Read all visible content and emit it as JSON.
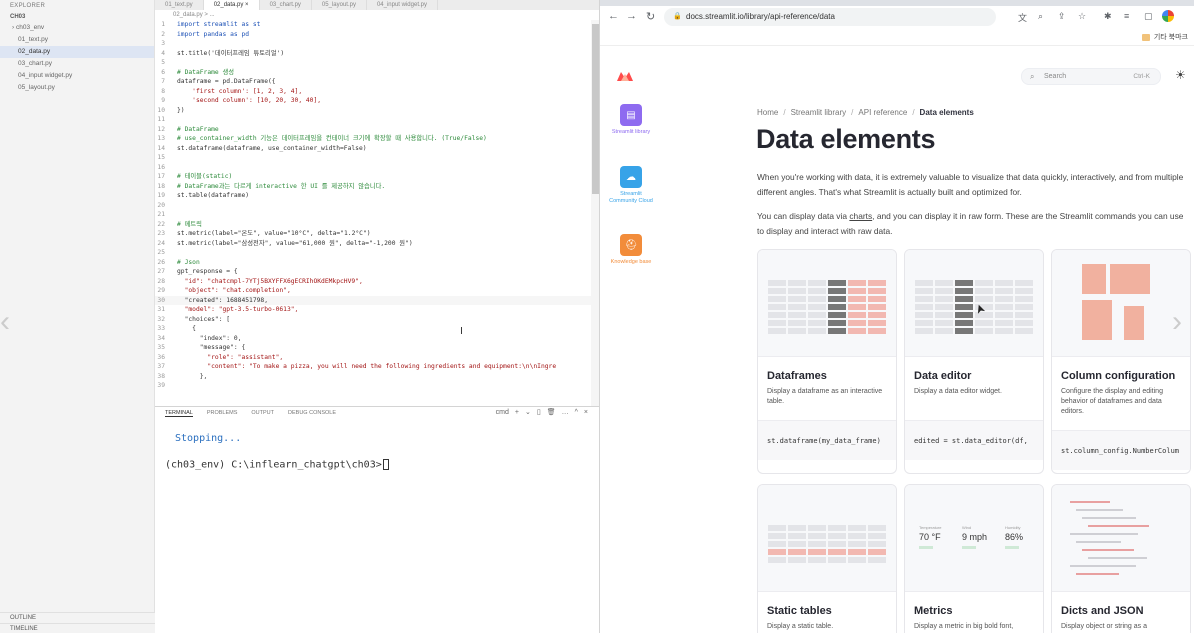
{
  "vscode": {
    "explorer": {
      "title": "EXPLORER",
      "folder": "CH03",
      "items": [
        {
          "label": "ch03_env",
          "sub": false,
          "active": false
        },
        {
          "label": "01_text.py",
          "sub": true,
          "active": false
        },
        {
          "label": "02_data.py",
          "sub": true,
          "active": true
        },
        {
          "label": "03_chart.py",
          "sub": true,
          "active": false
        },
        {
          "label": "04_input widget.py",
          "sub": true,
          "active": false
        },
        {
          "label": "05_layout.py",
          "sub": true,
          "active": false
        }
      ],
      "outline": "OUTLINE",
      "timeline": "TIMELINE"
    },
    "tabs": [
      "01_text.py",
      "02_data.py  ×",
      "03_chart.py",
      "05_layout.py",
      "04_input widget.py"
    ],
    "breadcrumb": "02_data.py > ...",
    "code_lines": [
      {
        "n": "1",
        "t": "import streamlit as st",
        "k": "kw"
      },
      {
        "n": "2",
        "t": "import pandas as pd",
        "k": "kw"
      },
      {
        "n": "3",
        "t": "",
        "k": ""
      },
      {
        "n": "4",
        "t": "st.title('데이터프레임 튜토리얼')",
        "k": ""
      },
      {
        "n": "5",
        "t": "",
        "k": ""
      },
      {
        "n": "6",
        "t": "# DataFrame 생성",
        "k": "cm"
      },
      {
        "n": "7",
        "t": "dataframe = pd.DataFrame({",
        "k": ""
      },
      {
        "n": "8",
        "t": "    'first column': [1, 2, 3, 4],",
        "k": "st"
      },
      {
        "n": "9",
        "t": "    'second column': [10, 20, 30, 40],",
        "k": "st"
      },
      {
        "n": "10",
        "t": "})",
        "k": ""
      },
      {
        "n": "11",
        "t": "",
        "k": ""
      },
      {
        "n": "12",
        "t": "# DataFrame",
        "k": "cm"
      },
      {
        "n": "13",
        "t": "# use_container_width 기능은 데이터프레임을 컨테이너 크기에 확장할 때 사용합니다. (True/False)",
        "k": "cm"
      },
      {
        "n": "14",
        "t": "st.dataframe(dataframe, use_container_width=False)",
        "k": ""
      },
      {
        "n": "15",
        "t": "",
        "k": ""
      },
      {
        "n": "16",
        "t": "",
        "k": ""
      },
      {
        "n": "17",
        "t": "# 테이블(static)",
        "k": "cm"
      },
      {
        "n": "18",
        "t": "# DataFrame과는 다르게 interactive 한 UI 를 제공하지 않습니다.",
        "k": "cm"
      },
      {
        "n": "19",
        "t": "st.table(dataframe)",
        "k": ""
      },
      {
        "n": "20",
        "t": "",
        "k": ""
      },
      {
        "n": "21",
        "t": "",
        "k": ""
      },
      {
        "n": "22",
        "t": "# 메트릭",
        "k": "cm"
      },
      {
        "n": "23",
        "t": "st.metric(label=\"온도\", value=\"10°C\", delta=\"1.2°C\")",
        "k": ""
      },
      {
        "n": "24",
        "t": "st.metric(label=\"삼성전자\", value=\"61,000 원\", delta=\"-1,200 원\")",
        "k": ""
      },
      {
        "n": "25",
        "t": "",
        "k": ""
      },
      {
        "n": "26",
        "t": "# Json",
        "k": "cm"
      },
      {
        "n": "27",
        "t": "gpt_response = {",
        "k": ""
      },
      {
        "n": "28",
        "t": "  \"id\": \"chatcmpl-7YTj5BXYFFX6gECRIhOKdEMkpcHV9\",",
        "k": "st"
      },
      {
        "n": "29",
        "t": "  \"object\": \"chat.completion\",",
        "k": "st"
      },
      {
        "n": "30",
        "t": "  \"created\": 1688451798,",
        "k": ""
      },
      {
        "n": "31",
        "t": "  \"model\": \"gpt-3.5-turbo-0613\",",
        "k": "st"
      },
      {
        "n": "32",
        "t": "  \"choices\": [",
        "k": ""
      },
      {
        "n": "33",
        "t": "    {",
        "k": ""
      },
      {
        "n": "34",
        "t": "      \"index\": 0,",
        "k": ""
      },
      {
        "n": "35",
        "t": "      \"message\": {",
        "k": ""
      },
      {
        "n": "36",
        "t": "        \"role\": \"assistant\",",
        "k": "st"
      },
      {
        "n": "37",
        "t": "        \"content\": \"To make a pizza, you will need the following ingredients and equipment:\\n\\nIngre",
        "k": "st"
      },
      {
        "n": "38",
        "t": "      },",
        "k": ""
      },
      {
        "n": "39",
        "t": "",
        "k": ""
      }
    ],
    "cursor_glyph": "I",
    "panel": {
      "tabs": [
        "TERMINAL",
        "PROBLEMS",
        "OUTPUT",
        "DEBUG CONSOLE"
      ],
      "shell_label": "cmd",
      "tools": [
        "+",
        "⌄",
        "▯",
        "🗑",
        "…",
        "^",
        "×"
      ],
      "stopping": "Stopping...",
      "prompt": "(ch03_env) C:\\inflearn_chatgpt\\ch03>"
    }
  },
  "browser": {
    "url": "docs.streamlit.io/library/api-reference/data",
    "nav": {
      "back": "←",
      "forward": "→",
      "reload": "↻"
    },
    "toolbar_icons": [
      "文",
      "⌕",
      "⇪",
      "☆",
      "✱",
      "≡",
      "▢"
    ],
    "bookmark": "기타 북마크",
    "sidebar": [
      {
        "label": "Streamlit library",
        "color": "#8e6bf0",
        "icon": "▤"
      },
      {
        "label": "Streamlit Community Cloud",
        "color": "#37a3e8",
        "icon": "☁"
      },
      {
        "label": "Knowledge base",
        "color": "#f28c3a",
        "icon": "⛑"
      }
    ],
    "search": {
      "placeholder": "Search",
      "shortcut": "Ctrl-K"
    },
    "crumbs": [
      "Home",
      "Streamlit library",
      "API reference",
      "Data elements"
    ],
    "title": "Data elements",
    "intro": "When you're working with data, it is extremely valuable to visualize that data quickly, interactively, and from multiple different angles. That's what Streamlit is actually built and optimized for.",
    "intro2_pre": "You can display data via ",
    "intro2_link": "charts",
    "intro2_post": ", and you can display it in raw form. These are the Streamlit commands you can use to display and interact with raw data.",
    "cards": [
      {
        "title": "Dataframes",
        "desc": "Display a dataframe as an interactive table.",
        "code": "st.dataframe(my_data_frame)"
      },
      {
        "title": "Data editor",
        "desc": "Display a data editor widget.",
        "code": "edited = st.data_editor(df,"
      },
      {
        "title": "Column configuration",
        "desc": "Configure the display and editing behavior of dataframes and data editors.",
        "code": "st.column_config.NumberColum"
      },
      {
        "title": "Static tables",
        "desc": "Display a static table.",
        "code": ""
      },
      {
        "title": "Metrics",
        "desc": "Display a metric in big bold font,",
        "code": ""
      },
      {
        "title": "Dicts and JSON",
        "desc": "Display object or string as a",
        "code": ""
      }
    ],
    "metrics_preview": [
      {
        "label": "Temperature",
        "value": "70 °F"
      },
      {
        "label": "Wind",
        "value": "9 mph"
      },
      {
        "label": "Humidity",
        "value": "86%"
      }
    ]
  }
}
